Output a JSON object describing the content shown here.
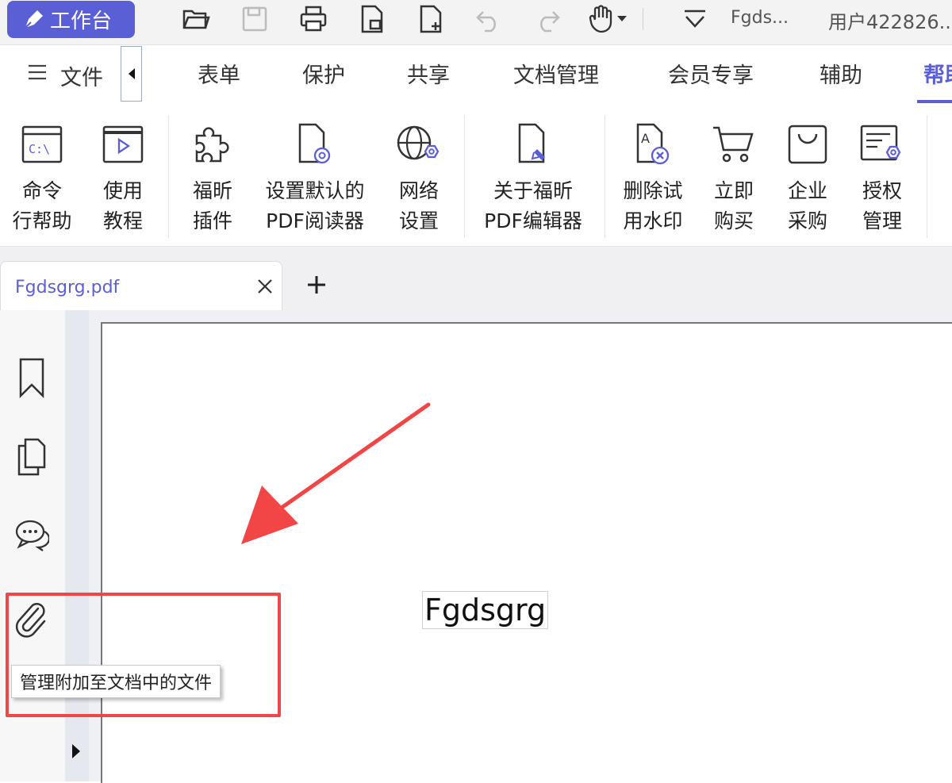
{
  "topbar": {
    "workbench_label": "工作台",
    "filename_short": "Fgds...",
    "user_label": "用户422826..."
  },
  "menubar": {
    "file_label": "文件",
    "tabs": [
      "表单",
      "保护",
      "共享",
      "文档管理",
      "会员专享",
      "辅助",
      "帮助"
    ],
    "active_tab": "帮助"
  },
  "ribbon": {
    "buttons": [
      {
        "line1": "命令",
        "line2": "行帮助",
        "icon": "command-line-icon"
      },
      {
        "line1": "使用",
        "line2": "教程",
        "icon": "tutorial-icon"
      },
      {
        "line1": "福昕",
        "line2": "插件",
        "icon": "puzzle-icon"
      },
      {
        "line1": "设置默认的",
        "line2": "PDF阅读器",
        "icon": "default-reader-icon"
      },
      {
        "line1": "网络",
        "line2": "设置",
        "icon": "network-settings-icon"
      },
      {
        "line1": "关于福昕",
        "line2": "PDF编辑器",
        "icon": "about-icon"
      },
      {
        "line1": "删除试",
        "line2": "用水印",
        "icon": "remove-watermark-icon"
      },
      {
        "line1": "立即",
        "line2": "购买",
        "icon": "cart-icon"
      },
      {
        "line1": "企业",
        "line2": "采购",
        "icon": "bag-icon"
      },
      {
        "line1": "授权",
        "line2": "管理",
        "icon": "license-icon"
      }
    ]
  },
  "tabs": {
    "doc_tab_label": "Fgdsgrg.pdf",
    "add_symbol": "+"
  },
  "document": {
    "text": "Fgdsgrg"
  },
  "sidebar": {
    "tooltip": "管理附加至文档中的文件"
  },
  "colors": {
    "accent": "#5b5fd6",
    "annotation_red": "#f24545"
  }
}
